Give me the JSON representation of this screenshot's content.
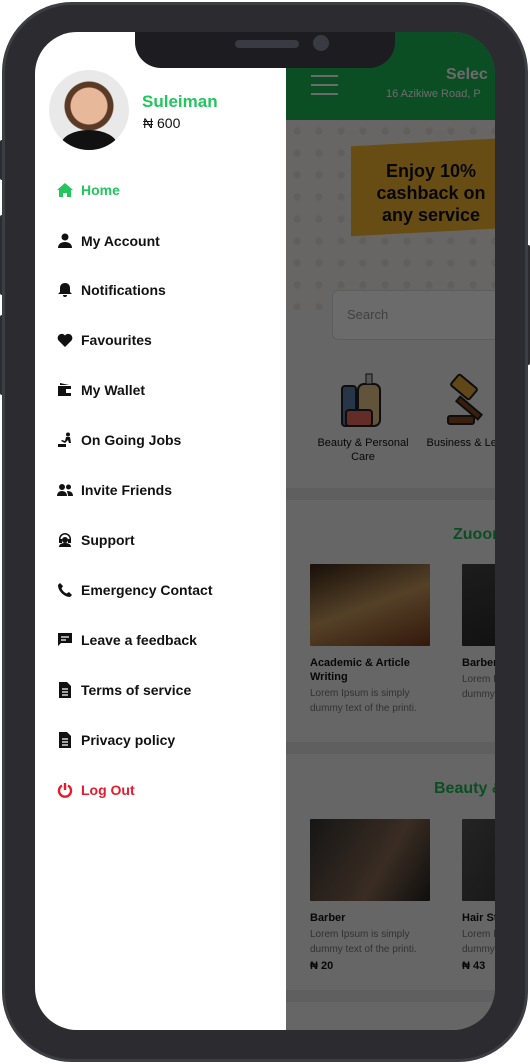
{
  "colors": {
    "accent": "#22c55e",
    "logout": "#e8192c",
    "header": "#1db954"
  },
  "drawer": {
    "user": {
      "name": "Suleiman",
      "balance": "₦ 600"
    },
    "items": [
      {
        "label": "Home",
        "icon": "home-icon",
        "active": true
      },
      {
        "label": "My Account",
        "icon": "person-icon"
      },
      {
        "label": "Notifications",
        "icon": "bell-icon"
      },
      {
        "label": "Favourites",
        "icon": "heart-icon"
      },
      {
        "label": "My Wallet",
        "icon": "wallet-icon"
      },
      {
        "label": "On Going Jobs",
        "icon": "worker-icon"
      },
      {
        "label": "Invite Friends",
        "icon": "group-icon"
      },
      {
        "label": "Support",
        "icon": "headset-icon"
      },
      {
        "label": "Emergency Contact",
        "icon": "phone-icon"
      },
      {
        "label": "Leave a feedback",
        "icon": "feedback-icon"
      },
      {
        "label": "Terms of service",
        "icon": "document-icon"
      },
      {
        "label": "Privacy policy",
        "icon": "document-icon"
      },
      {
        "label": "Log Out",
        "icon": "power-icon"
      }
    ]
  },
  "main": {
    "header": {
      "title": "Selec",
      "address": "16 Azikiwe Road, P"
    },
    "banner": {
      "text": "Enjoy 10% cashback on any service"
    },
    "search": {
      "placeholder": "Search"
    },
    "categories": [
      {
        "label": "Beauty & Personal Care",
        "icon": "cosmetics-icon"
      },
      {
        "label": "Business & Legal",
        "icon": "gavel-icon"
      }
    ],
    "sections": [
      {
        "title": "Zuoor",
        "cards": [
          {
            "title": "Academic & Article Writing",
            "desc": "Lorem Ipsum is simply dummy text of the printi."
          },
          {
            "title": "Barber",
            "desc": "Lorem Ipsum is simply dummy text of the printi."
          }
        ]
      },
      {
        "title": "Beauty &",
        "cards": [
          {
            "title": "Barber",
            "desc": "Lorem Ipsum is simply dummy text of the printi.",
            "price": "₦ 20"
          },
          {
            "title": "Hair St",
            "desc": "Lorem Ipsum is simply dummy text of the printi.",
            "price": "₦ 43"
          }
        ]
      }
    ]
  }
}
